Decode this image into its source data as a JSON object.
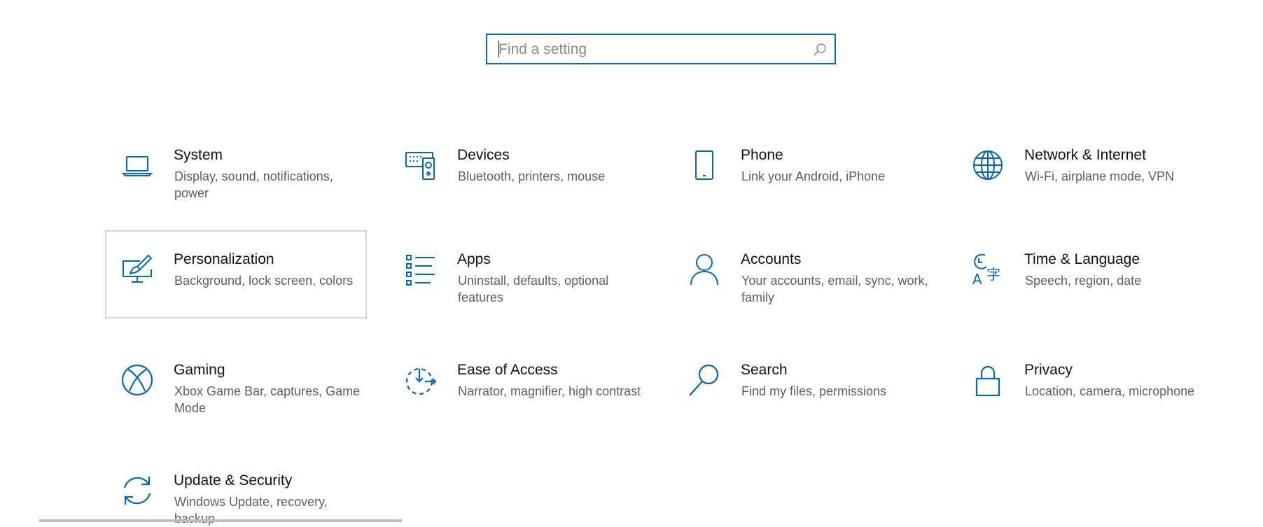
{
  "search": {
    "placeholder": "Find a setting",
    "value": ""
  },
  "colors": {
    "accent": "#0067c0",
    "selected_border": "#d4d4d4",
    "desc_text": "#5f5f5f"
  },
  "tiles": [
    {
      "icon": "laptop-icon",
      "title": "System",
      "desc": "Display, sound, notifications, power"
    },
    {
      "icon": "keyboard-speaker-icon",
      "title": "Devices",
      "desc": "Bluetooth, printers, mouse"
    },
    {
      "icon": "phone-icon",
      "title": "Phone",
      "desc": "Link your Android, iPhone"
    },
    {
      "icon": "globe-icon",
      "title": "Network & Internet",
      "desc": "Wi-Fi, airplane mode, VPN"
    },
    {
      "icon": "paintbrush-monitor-icon",
      "title": "Personalization",
      "desc": "Background, lock screen, colors",
      "selected": true
    },
    {
      "icon": "apps-list-icon",
      "title": "Apps",
      "desc": "Uninstall, defaults, optional features"
    },
    {
      "icon": "person-icon",
      "title": "Accounts",
      "desc": "Your accounts, email, sync, work, family"
    },
    {
      "icon": "time-language-icon",
      "title": "Time & Language",
      "desc": "Speech, region, date"
    },
    {
      "icon": "xbox-icon",
      "title": "Gaming",
      "desc": "Xbox Game Bar, captures, Game Mode"
    },
    {
      "icon": "ease-of-access-icon",
      "title": "Ease of Access",
      "desc": "Narrator, magnifier, high contrast"
    },
    {
      "icon": "magnifier-icon",
      "title": "Search",
      "desc": "Find my files, permissions"
    },
    {
      "icon": "lock-icon",
      "title": "Privacy",
      "desc": "Location, camera, microphone"
    },
    {
      "icon": "sync-arrows-icon",
      "title": "Update & Security",
      "desc": "Windows Update, recovery, backup"
    }
  ],
  "time_language_glyphs": {
    "a": "A",
    "zi": "字"
  }
}
